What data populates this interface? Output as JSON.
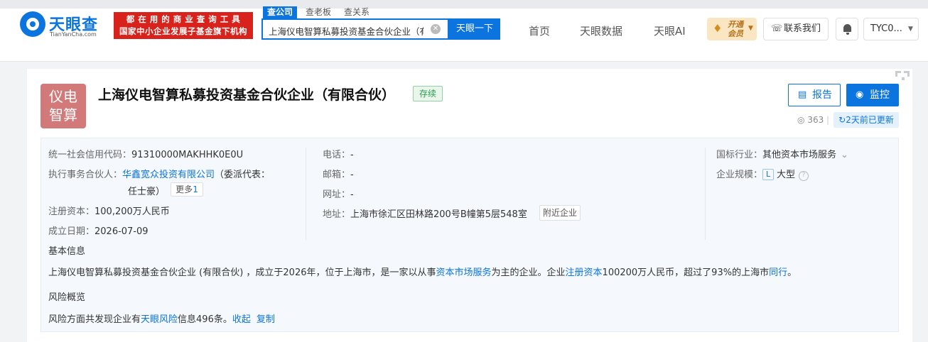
{
  "brand": {
    "name": "天眼查",
    "domain": "TianYanCha.com",
    "slogan_line1": "都 在 用 的 商 业 查 询 工 具",
    "slogan_line2": "国家中小企业发展子基金旗下机构"
  },
  "search": {
    "tabs": [
      "查公司",
      "查老板",
      "查关系"
    ],
    "value": "上海仪电智算私募投资基金合伙企业（有限",
    "button": "天眼一下"
  },
  "nav": {
    "items": [
      "首页",
      "天眼数据",
      "天眼AI"
    ],
    "vip_line1": "开通",
    "vip_line2": "会员",
    "contact": "联系我们",
    "user": "TYC0..."
  },
  "company": {
    "avatar_line1": "仪电",
    "avatar_line2": "智算",
    "name": "上海仪电智算私募投资基金合伙企业（有限合伙）",
    "status": "存续",
    "report_label": "报告",
    "monitor_label": "监控",
    "views": "363",
    "updated": "2天前已更新"
  },
  "details": {
    "credit_code_label": "统一社会信用代码：",
    "credit_code": "91310000MAKHHK0E0U",
    "partner_label": "执行事务合伙人：",
    "partner_name": "华鑫宽众投资有限公司",
    "partner_rep_prefix": "（委派代表：",
    "partner_rep": "任士豪）",
    "more_label": "更多",
    "more_count": "1",
    "capital_label": "注册资本：",
    "capital": "100,200万人民币",
    "founded_label": "成立日期：",
    "founded": "2026-07-09",
    "phone_label": "电话：",
    "phone": "-",
    "email_label": "邮箱：",
    "email": "-",
    "website_label": "网址：",
    "website": "-",
    "address_label": "地址：",
    "address": "上海市徐汇区田林路200号B幢第5层548室",
    "nearby_label": "附近企业",
    "industry_label": "国标行业：",
    "industry": "其他资本市场服务",
    "scale_label": "企业规模：",
    "scale_badge": "L",
    "scale": "大型"
  },
  "basic": {
    "title": "基本信息",
    "p1": "上海仪电智算私募投资基金合伙企业 (有限合伙) ，成立于2026年，位于上海市，是一家以从事",
    "p1_link1": "资本市场服务",
    "p1_mid": "为主的企业。企业",
    "p1_link2": "注册资本",
    "p1_tail": "100200万人民币，超过了93%的上海市",
    "p1_link3": "同行",
    "p1_end": "。"
  },
  "risk": {
    "title": "风险概览",
    "prefix": "风险方面共发现企业有",
    "link": "天眼风险",
    "suffix": "信息496条。",
    "collapse": "收起",
    "copy": "复制"
  },
  "colors": {
    "brand_blue": "#0b74de",
    "slogan_red": "#d8231c",
    "avatar_bg": "#d27a7a",
    "status_green": "#2a9d4e"
  }
}
